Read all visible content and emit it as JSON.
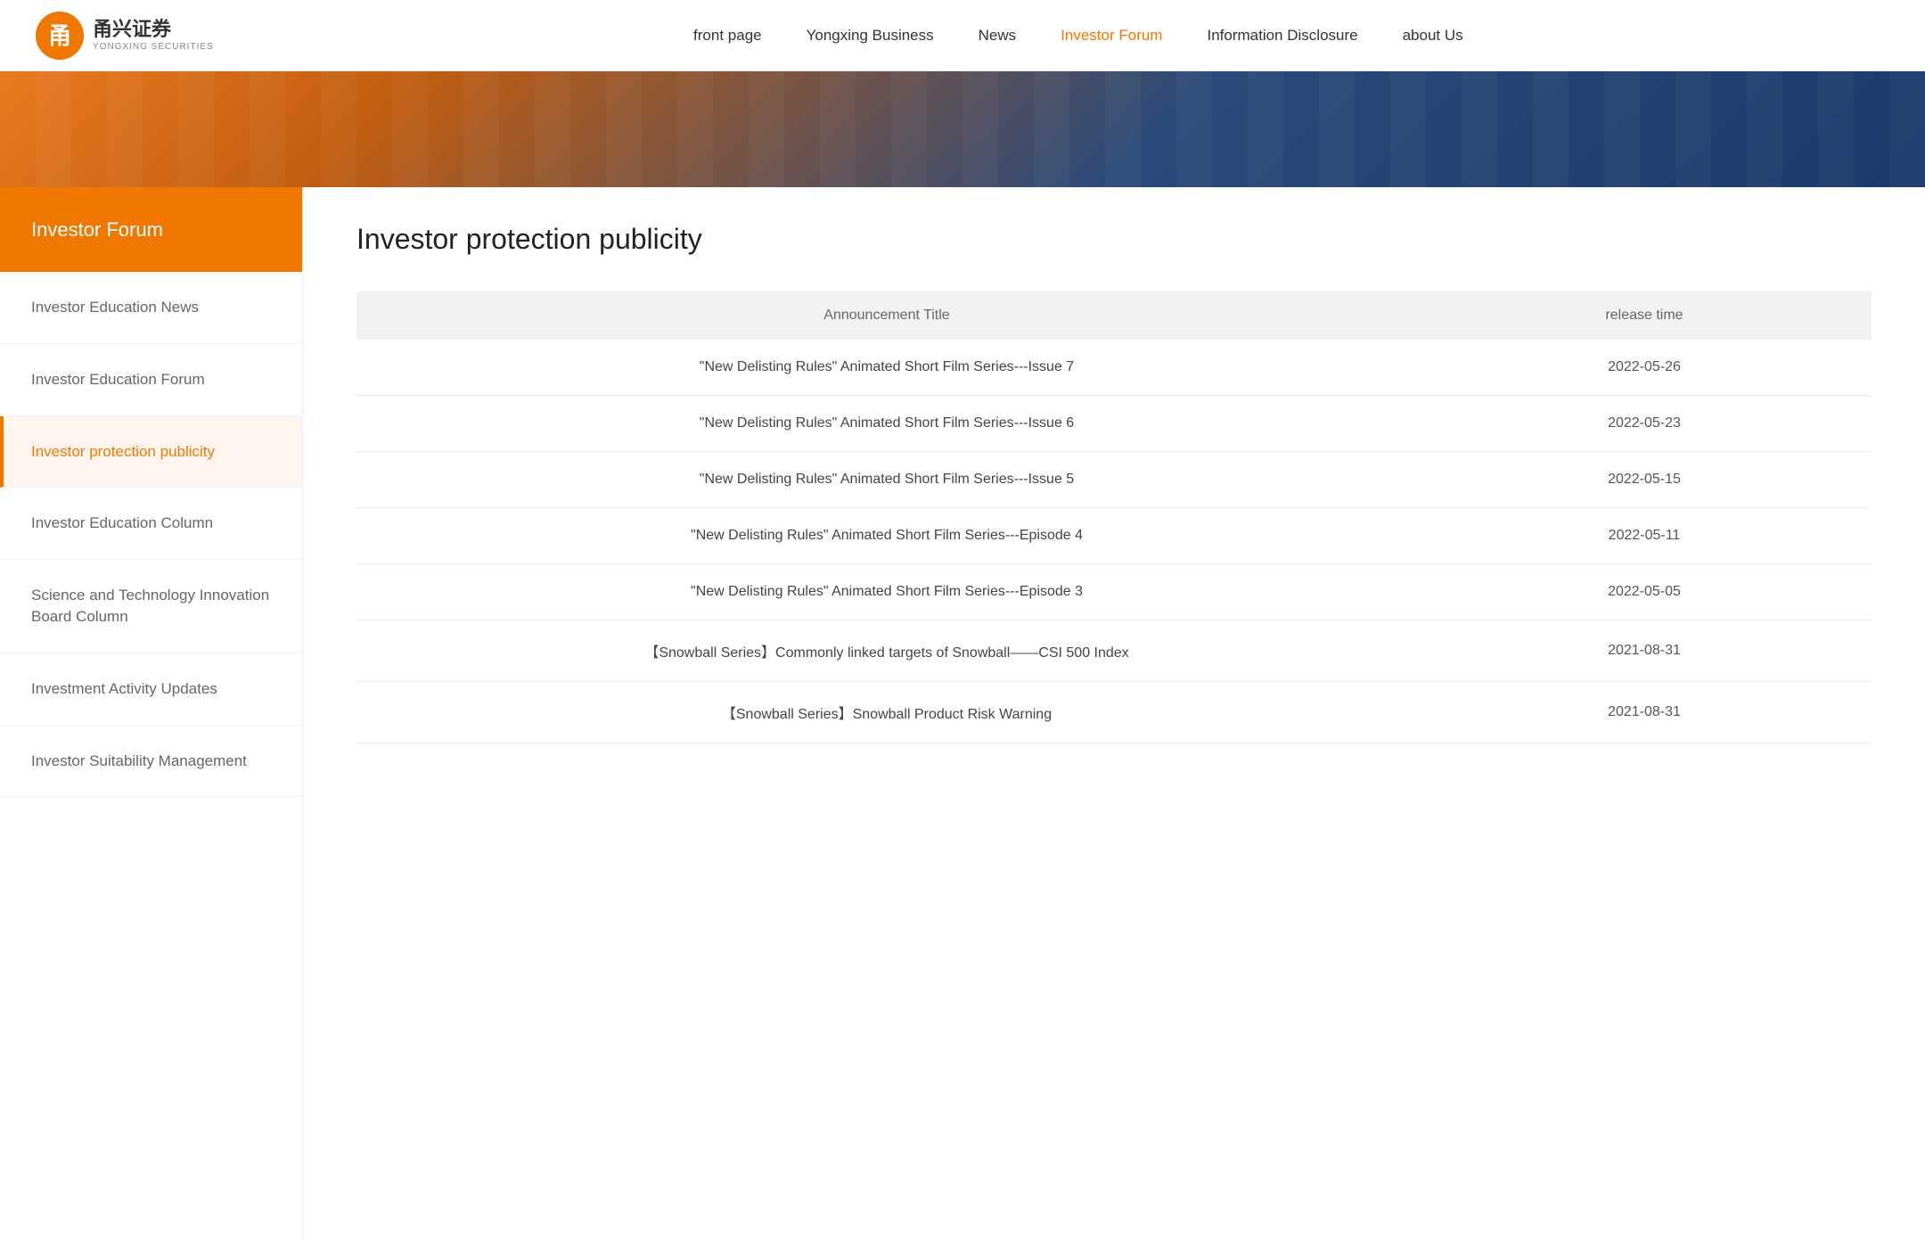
{
  "header": {
    "logo_cn": "甬兴证券",
    "logo_en": "YONGXING SECURITIES",
    "nav_items": [
      {
        "id": "front-page",
        "label": "front page",
        "active": false
      },
      {
        "id": "yongxing-business",
        "label": "Yongxing Business",
        "active": false
      },
      {
        "id": "news",
        "label": "News",
        "active": false
      },
      {
        "id": "investor-forum",
        "label": "Investor Forum",
        "active": true
      },
      {
        "id": "information-disclosure",
        "label": "Information Disclosure",
        "active": false
      },
      {
        "id": "about-us",
        "label": "about Us",
        "active": false
      }
    ]
  },
  "sidebar": {
    "header_label": "Investor Forum",
    "items": [
      {
        "id": "investor-education-news",
        "label": "Investor Education News",
        "active": false
      },
      {
        "id": "investor-education-forum",
        "label": "Investor Education Forum",
        "active": false
      },
      {
        "id": "investor-protection-publicity",
        "label": "Investor protection publicity",
        "active": true
      },
      {
        "id": "investor-education-column",
        "label": "Investor Education Column",
        "active": false
      },
      {
        "id": "science-technology-board",
        "label": "Science and Technology Innovation Board Column",
        "active": false
      },
      {
        "id": "investment-activity-updates",
        "label": "Investment Activity Updates",
        "active": false
      },
      {
        "id": "investor-suitability-management",
        "label": "Investor Suitability Management",
        "active": false
      }
    ]
  },
  "content": {
    "page_title": "Investor protection publicity",
    "table": {
      "col_title": "Announcement Title",
      "col_date": "release time",
      "rows": [
        {
          "title": "\"New Delisting Rules\" Animated Short Film Series---Issue 7",
          "date": "2022-05-26"
        },
        {
          "title": "\"New Delisting Rules\" Animated Short Film Series---Issue 6",
          "date": "2022-05-23"
        },
        {
          "title": "\"New Delisting Rules\" Animated Short Film Series---Issue 5",
          "date": "2022-05-15"
        },
        {
          "title": "\"New Delisting Rules\" Animated Short Film Series---Episode 4",
          "date": "2022-05-11"
        },
        {
          "title": "\"New Delisting Rules\" Animated Short Film Series---Episode 3",
          "date": "2022-05-05"
        },
        {
          "title": "【Snowball Series】Commonly linked targets of Snowball——CSI 500 Index",
          "date": "2021-08-31"
        },
        {
          "title": "【Snowball Series】Snowball Product Risk Warning",
          "date": "2021-08-31"
        }
      ]
    }
  },
  "colors": {
    "accent": "#f07800",
    "active_bg": "#fff5ee"
  }
}
